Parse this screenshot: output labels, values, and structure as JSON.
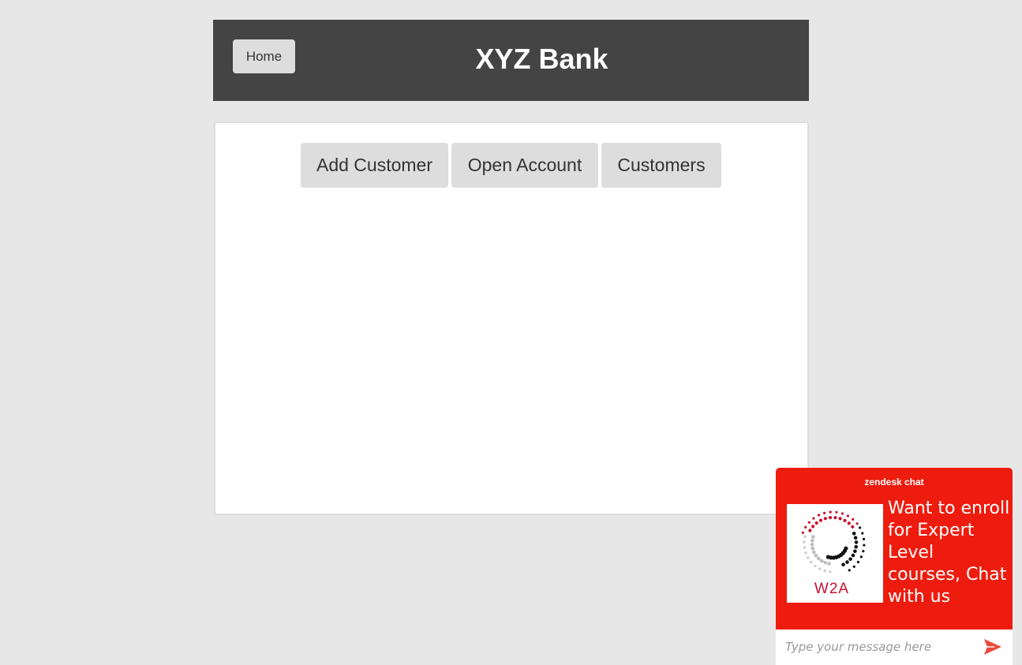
{
  "header": {
    "home_label": "Home",
    "title": "XYZ Bank"
  },
  "manager_panel": {
    "tabs": [
      {
        "label": "Add Customer"
      },
      {
        "label": "Open Account"
      },
      {
        "label": "Customers"
      }
    ]
  },
  "chat_widget": {
    "brand": "zendesk chat",
    "logo_text": "W2A",
    "message": "Want to enroll for Expert Level courses, Chat with us",
    "input_placeholder": "Type your message here",
    "send_icon": "send-arrow-icon",
    "accent_color": "#ee1c0e"
  },
  "colors": {
    "page_background": "#e7e7e7",
    "header_background": "#444444",
    "button_background": "#dddddd"
  }
}
